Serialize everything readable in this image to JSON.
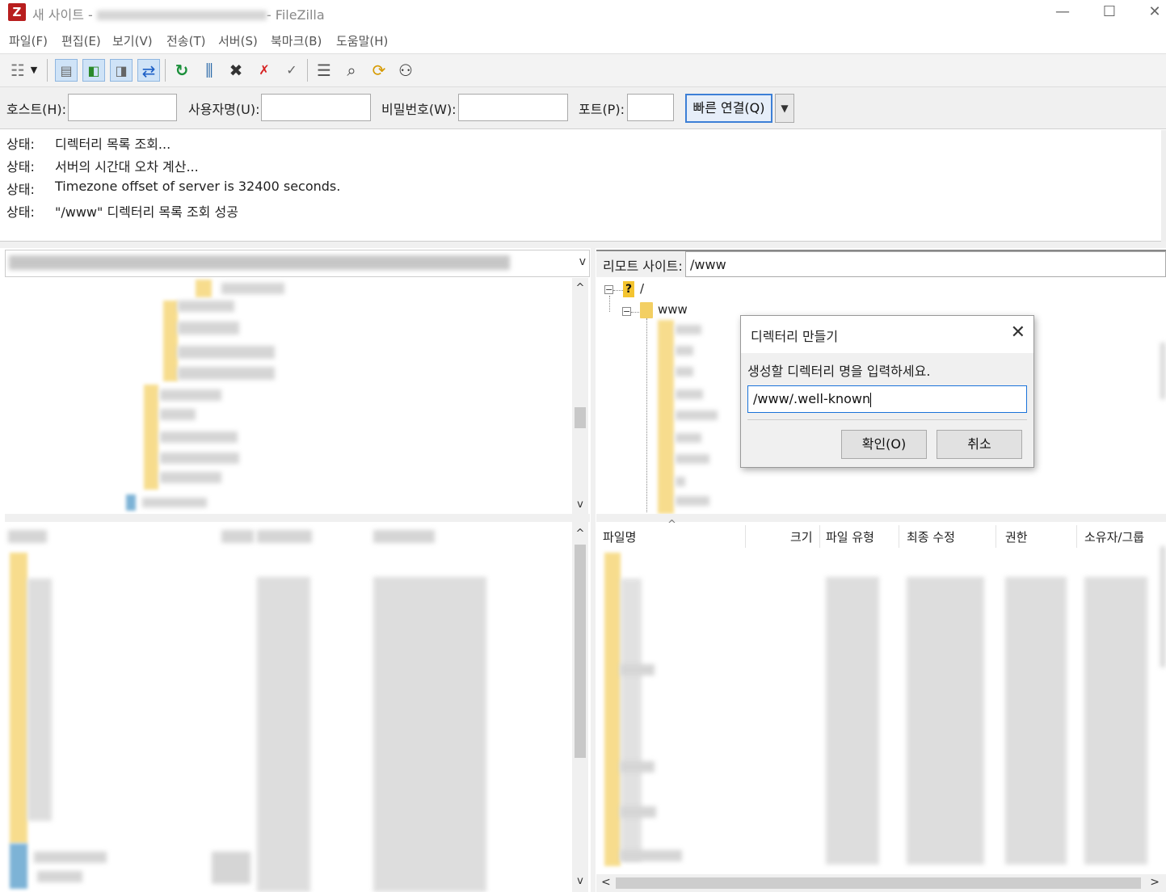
{
  "window": {
    "title_prefix": "새 사이트 - ",
    "title_suffix": "- FileZilla",
    "app_icon": "Z",
    "minimize": "—",
    "maximize": "☐",
    "close": "✕"
  },
  "menu": [
    "파일(F)",
    "편집(E)",
    "보기(V)",
    "전송(T)",
    "서버(S)",
    "북마크(B)",
    "도움말(H)"
  ],
  "toolbar": {
    "icons": [
      "site-manager-icon",
      "toggle-log-icon",
      "toggle-local-tree-icon",
      "toggle-remote-tree-icon",
      "toggle-queue-icon",
      "refresh-icon",
      "process-queue-icon",
      "cancel-icon",
      "disconnect-icon",
      "reconnect-icon",
      "filter-icon",
      "search-icon",
      "compare-icon",
      "find-icon"
    ]
  },
  "quickconnect": {
    "host_label": "호스트(H):",
    "user_label": "사용자명(U):",
    "pass_label": "비밀번호(W):",
    "port_label": "포트(P):",
    "host_value": "",
    "user_value": "",
    "pass_value": "",
    "port_value": "",
    "connect_button": "빠른 연결(Q)",
    "dropdown": "▼"
  },
  "log": [
    {
      "label": "상태:",
      "text": "디렉터리 목록 조회..."
    },
    {
      "label": "상태:",
      "text": "서버의 시간대 오차 계산..."
    },
    {
      "label": "상태:",
      "text": "Timezone offset of server is 32400 seconds."
    },
    {
      "label": "상태:",
      "text": "\"/www\" 디렉터리 목록 조회 성공"
    }
  ],
  "remote": {
    "site_label": "리모트 사이트:",
    "path": "/www",
    "tree_root": "/",
    "tree_child": "www",
    "columns": [
      "파일명",
      "크기",
      "파일 유형",
      "최종 수정",
      "권한",
      "소유자/그룹"
    ],
    "sort_indicator": "^"
  },
  "dialog": {
    "title": "디렉터리 만들기",
    "close": "✕",
    "message": "생성할 디렉터리 명을 입력하세요.",
    "input_value": "/www/.well-known",
    "ok": "확인(O)",
    "cancel": "취소"
  },
  "scroll": {
    "up": "^",
    "down": "v",
    "left": "<",
    "right": ">",
    "dropdown": "v"
  }
}
